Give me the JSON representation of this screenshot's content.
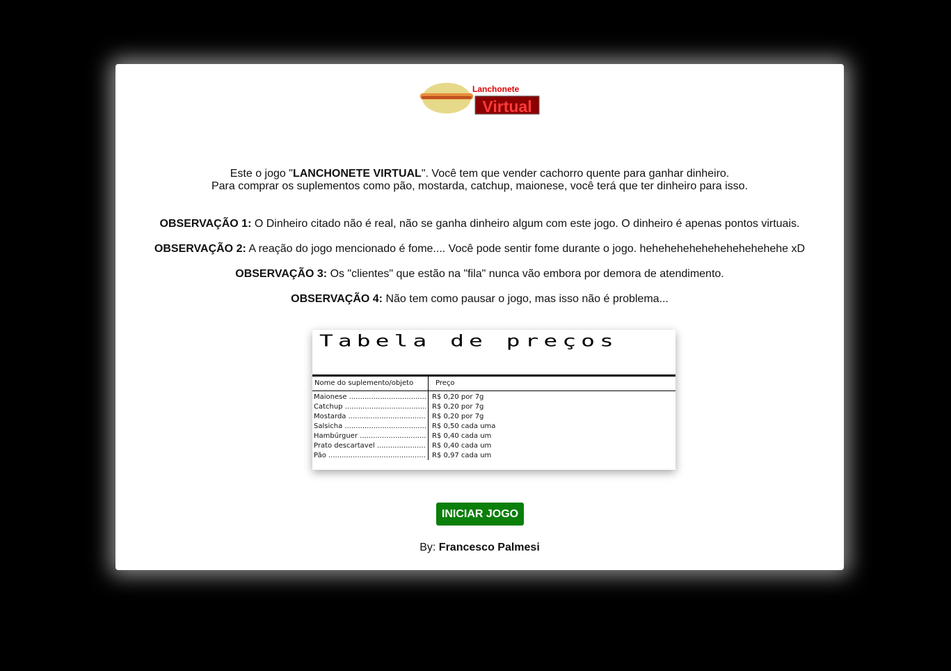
{
  "logo": {
    "line1": "Lanchonete",
    "line2": "Virtual",
    "icon": "hotdog-icon"
  },
  "intro": {
    "line1_pre": "Este o jogo \"",
    "line1_bold": "LANCHONETE VIRTUAL",
    "line1_post": "\". Você tem que vender cachorro quente para ganhar dinheiro.",
    "line2": "Para comprar os suplementos como pão, mostarda, catchup, maionese, você terá que ter dinheiro para isso."
  },
  "observations": [
    {
      "label": "OBSERVAÇÃO 1:",
      "text": " O Dinheiro citado não é real, não se ganha dinheiro algum com este jogo. O dinheiro é apenas pontos virtuais."
    },
    {
      "label": "OBSERVAÇÃO 2:",
      "text": " A reação do jogo mencionado é fome.... Você pode sentir fome durante o jogo. hehehehehehehehehehehehe xD"
    },
    {
      "label": "OBSERVAÇÃO 3:",
      "text": " Os \"clientes\" que estão na \"fila\" nunca vão embora por demora de atendimento."
    },
    {
      "label": "OBSERVAÇÃO 4:",
      "text": " Não tem como pausar o jogo, mas isso não é problema..."
    }
  ],
  "price_table": {
    "title": "Tabela de preços",
    "col1": "Nome do suplemento/objeto",
    "col2": "Preço",
    "rows": [
      {
        "name": "Maionese",
        "price": "R$ 0,20 por 7g"
      },
      {
        "name": "Catchup",
        "price": "R$ 0,20 por 7g"
      },
      {
        "name": "Mostarda",
        "price": "R$ 0,20 por 7g"
      },
      {
        "name": "Salsicha",
        "price": "R$ 0,50 cada uma"
      },
      {
        "name": "Hambúrguer",
        "price": "R$ 0,40 cada um"
      },
      {
        "name": "Prato descartavel",
        "price": "R$ 0,40 cada um"
      },
      {
        "name": "Pão",
        "price": "R$ 0,97 cada um"
      }
    ]
  },
  "start_button": "INICIAR JOGO",
  "credit": {
    "prefix": "By: ",
    "author": "Francesco Palmesi"
  },
  "colors": {
    "background": "#000000",
    "panel": "#ffffff",
    "button": "#0a7f0a",
    "logo_red": "#e00000",
    "logo_dark_red": "#8b0000"
  }
}
